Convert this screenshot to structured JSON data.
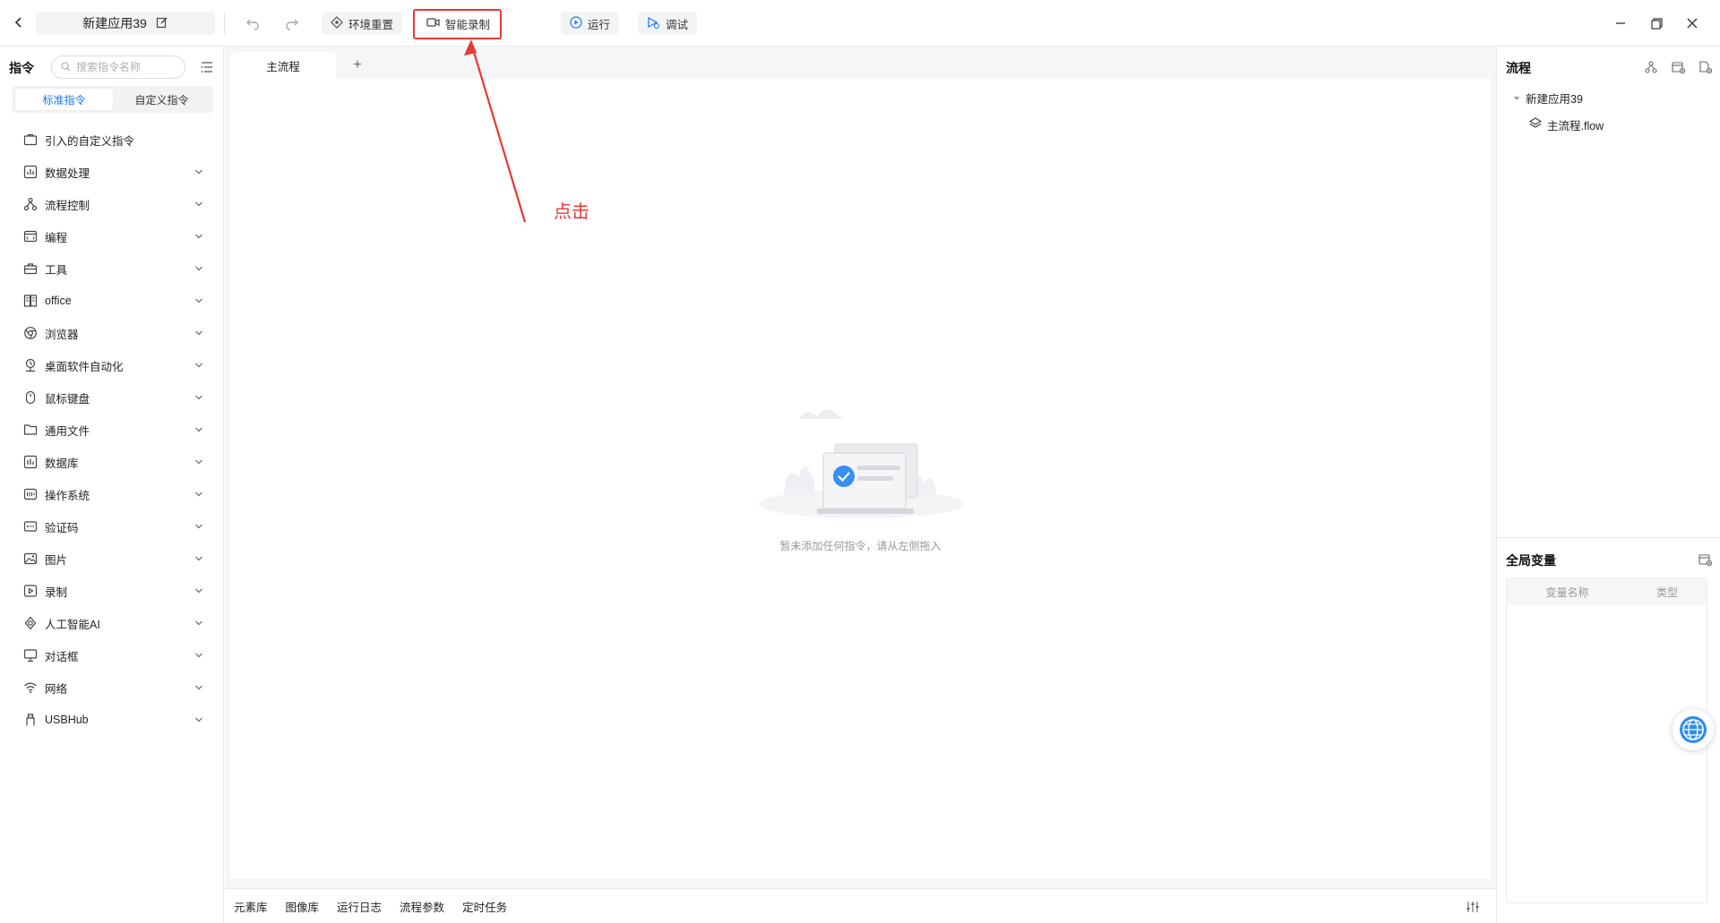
{
  "topbar": {
    "app_title": "新建应用39",
    "reset_env_label": "环境重置",
    "smart_record_label": "智能录制",
    "run_label": "运行",
    "debug_label": "调试"
  },
  "sidebar": {
    "title": "指令",
    "search_placeholder": "搜索指令名称",
    "tabs": [
      {
        "label": "标准指令",
        "active": true
      },
      {
        "label": "自定义指令",
        "active": false
      }
    ],
    "categories": [
      {
        "label": "引入的自定义指令",
        "icon": "briefcase-icon",
        "expandable": false
      },
      {
        "label": "数据处理",
        "icon": "data-icon",
        "expandable": true
      },
      {
        "label": "流程控制",
        "icon": "flow-icon",
        "expandable": true
      },
      {
        "label": "编程",
        "icon": "code-icon",
        "expandable": true
      },
      {
        "label": "工具",
        "icon": "toolbox-icon",
        "expandable": true
      },
      {
        "label": "office",
        "icon": "office-icon",
        "expandable": true
      },
      {
        "label": "浏览器",
        "icon": "browser-icon",
        "expandable": true
      },
      {
        "label": "桌面软件自动化",
        "icon": "desktop-automation-icon",
        "expandable": true
      },
      {
        "label": "鼠标键盘",
        "icon": "mouse-icon",
        "expandable": true
      },
      {
        "label": "通用文件",
        "icon": "folder-icon",
        "expandable": true
      },
      {
        "label": "数据库",
        "icon": "database-icon",
        "expandable": true
      },
      {
        "label": "操作系统",
        "icon": "os-icon",
        "expandable": true
      },
      {
        "label": "验证码",
        "icon": "captcha-icon",
        "expandable": true
      },
      {
        "label": "图片",
        "icon": "image-icon",
        "expandable": true
      },
      {
        "label": "录制",
        "icon": "record-icon",
        "expandable": true
      },
      {
        "label": "人工智能AI",
        "icon": "ai-icon",
        "expandable": true
      },
      {
        "label": "对话框",
        "icon": "monitor-icon",
        "expandable": true
      },
      {
        "label": "网络",
        "icon": "wifi-icon",
        "expandable": true
      },
      {
        "label": "USBHub",
        "icon": "usb-icon",
        "expandable": true
      }
    ]
  },
  "editor": {
    "tab_label": "主流程",
    "add_tab": "+",
    "empty_text": "暂未添加任何指令，请从左侧拖入"
  },
  "bottombar": {
    "items": [
      "元素库",
      "图像库",
      "运行日志",
      "流程参数",
      "定时任务"
    ]
  },
  "flow_panel": {
    "title": "流程",
    "root": "新建应用39",
    "child": "主流程.flow"
  },
  "global_vars": {
    "title": "全局变量",
    "col_name": "变量名称",
    "col_type": "类型"
  },
  "annotation": {
    "text": "点击"
  },
  "colors": {
    "accent": "#1677ff",
    "annotation": "#e53935"
  }
}
